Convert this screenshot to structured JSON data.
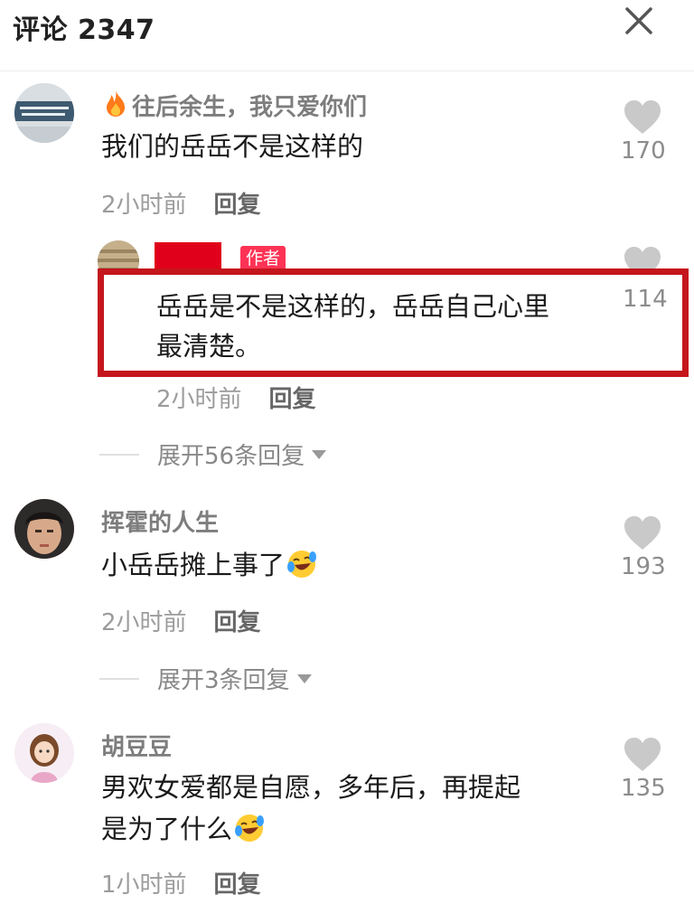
{
  "header": {
    "title": "评论 2347"
  },
  "comments": [
    {
      "username": "往后余生，我只爱你们",
      "text": "我们的岳岳不是这样的",
      "time": "2小时前",
      "reply_label": "回复",
      "likes": "170",
      "avatar_icon": "photo-avatar",
      "name_icon": "fire-icon",
      "replies": [
        {
          "username": "…",
          "badge": "作者",
          "text_lines": [
            "岳岳是不是这样的，岳岳自己心里",
            "最清楚。"
          ],
          "time": "2小时前",
          "reply_label": "回复",
          "likes": "114",
          "highlighted": true
        }
      ],
      "expand_label": "展开56条回复"
    },
    {
      "username": "挥霍的人生",
      "text": "小岳岳摊上事了",
      "text_emoji": "laughing-tears-emoji",
      "time": "2小时前",
      "reply_label": "回复",
      "likes": "193",
      "expand_label": "展开3条回复"
    },
    {
      "username": "胡豆豆",
      "text_lines": [
        "男欢女爱都是自愿，多年后，再提起",
        "是为了什么"
      ],
      "text_emoji": "laughing-tears-emoji",
      "time": "1小时前",
      "reply_label": "回复",
      "likes": "135"
    }
  ],
  "colors": {
    "highlight_border": "#c4161c",
    "author_badge": "#ff3355",
    "redaction": "#e0001b"
  }
}
